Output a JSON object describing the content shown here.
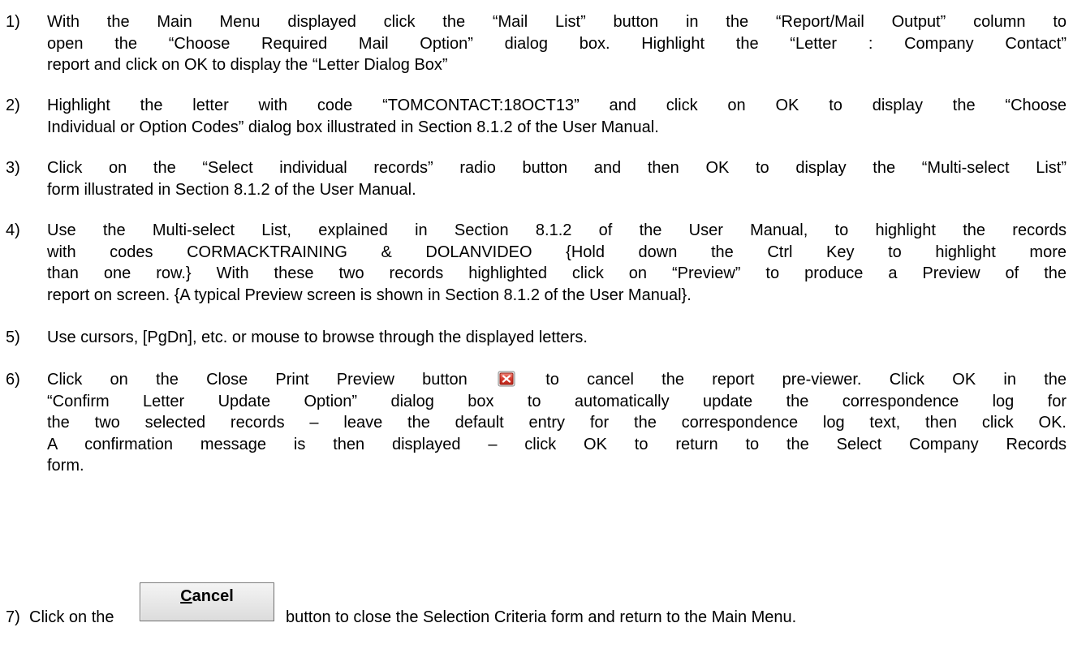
{
  "steps": [
    {
      "num": "1)",
      "lines": [
        "With the Main Menu displayed click the “Mail List” button in the “Report/Mail Output” column to",
        "open the “Choose Required Mail Option” dialog box. Highlight the “Letter : Company Contact”",
        "report and click on OK to display the “Letter Dialog Box”"
      ]
    },
    {
      "num": "2)",
      "lines": [
        "Highlight the letter with code “TOMCONTACT:18OCT13” and click on OK to display the “Choose",
        "Individual or Option Codes” dialog box illustrated in Section 8.1.2 of the User Manual."
      ]
    },
    {
      "num": "3)",
      "lines": [
        "Click on the “Select individual records” radio button and then OK to display the “Multi-select List”",
        "form illustrated in Section 8.1.2 of the User Manual."
      ]
    },
    {
      "num": "4)",
      "lines": [
        "Use the Multi-select List, explained in Section 8.1.2 of the User Manual, to highlight the records",
        "with codes  CORMACKTRAINING & DOLANVIDEO {Hold down the Ctrl Key to highlight more",
        "than one row.} With these two records highlighted click on “Preview” to produce a Preview of the",
        "report on screen. {A typical Preview screen is shown in Section 8.1.2 of the User Manual}."
      ]
    },
    {
      "num": "5)",
      "lines": [
        "Use cursors,  [PgDn], etc. or mouse to browse through the displayed letters."
      ]
    },
    {
      "num": "6)",
      "line1_before": "Click on the Close Print Preview button",
      "line1_after": "to cancel the report pre-viewer. Click OK in the",
      "lines": [
        "“Confirm Letter Update Option” dialog box to automatically update the correspondence log for",
        "the two selected records – leave the default entry for the correspondence log text, then click OK.",
        "A confirmation message is then displayed – click OK to return to the Select Company Records",
        "form."
      ]
    },
    {
      "num": "7)",
      "before": "Click on the",
      "after": "button to close the Selection Criteria form and return to the Main Menu."
    }
  ],
  "cancel_button": {
    "mnemonic": "C",
    "rest": "ancel"
  },
  "colors": {
    "close_icon_red": "#d83a2e",
    "close_icon_border": "#9c1f14",
    "text": "#000000"
  },
  "icons": {
    "close_preview": "close-icon"
  }
}
